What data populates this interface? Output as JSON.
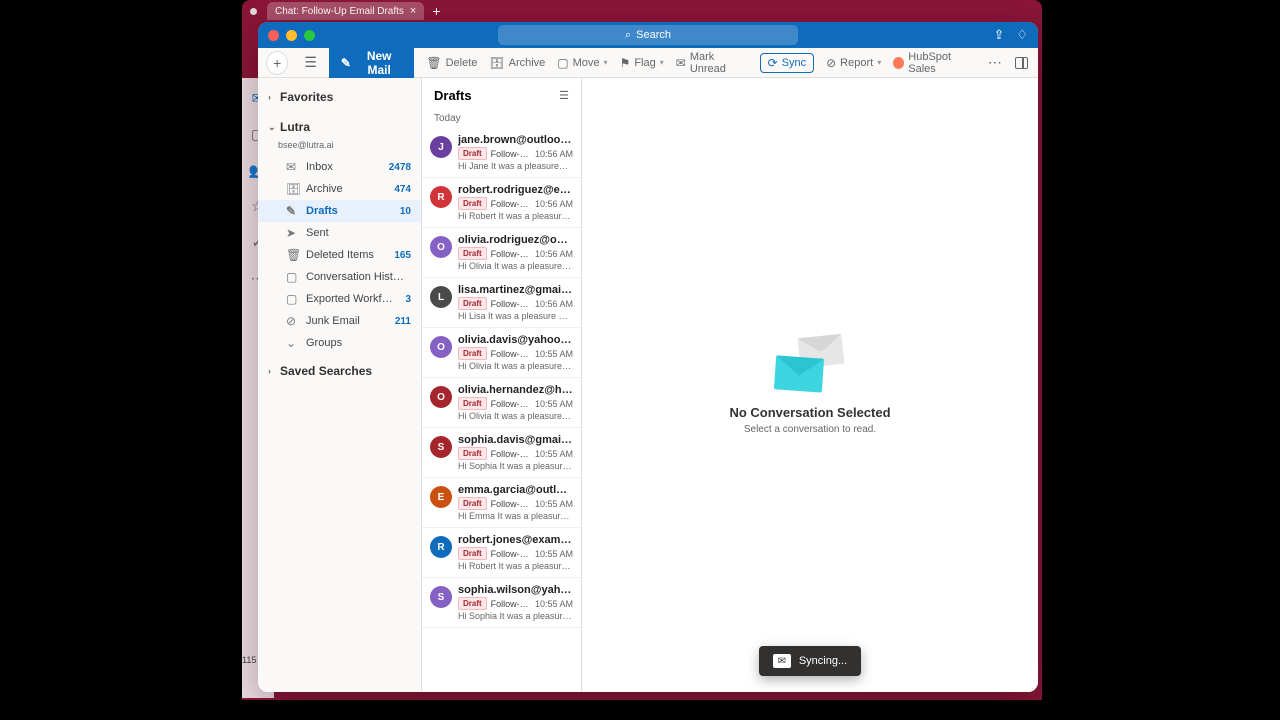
{
  "browser": {
    "tab_title": "Chat: Follow-Up Email Drafts"
  },
  "titlebar": {
    "search_placeholder": "Search"
  },
  "toolbar": {
    "new_mail": "New Mail",
    "delete": "Delete",
    "archive": "Archive",
    "move": "Move",
    "flag": "Flag",
    "mark_unread": "Mark Unread",
    "sync": "Sync",
    "report": "Report",
    "hubspot": "HubSpot Sales"
  },
  "sidebar": {
    "favorites": "Favorites",
    "account_name": "Lutra",
    "account_email": "bsee@lutra.ai",
    "folders": [
      {
        "name": "Inbox",
        "count": "2478",
        "icon": "✉"
      },
      {
        "name": "Archive",
        "count": "474",
        "icon": "🗄"
      },
      {
        "name": "Drafts",
        "count": "10",
        "icon": "✎",
        "selected": true
      },
      {
        "name": "Sent",
        "count": "",
        "icon": "➤"
      },
      {
        "name": "Deleted Items",
        "count": "165",
        "icon": "🗑"
      },
      {
        "name": "Conversation Hist…",
        "count": "",
        "icon": "▢"
      },
      {
        "name": "Exported Workf…",
        "count": "3",
        "icon": "▢"
      },
      {
        "name": "Junk Email",
        "count": "211",
        "icon": "⊘"
      },
      {
        "name": "Groups",
        "count": "",
        "icon": "⌄"
      }
    ],
    "saved_searches": "Saved Searches"
  },
  "msglist": {
    "title": "Drafts",
    "group": "Today",
    "draft_label": "Draft",
    "items": [
      {
        "initial": "J",
        "color": "#6b3fa0",
        "from": "jane.brown@outlook…",
        "subject": "Follow-…",
        "time": "10:56 AM",
        "preview": "Hi Jane It was a pleasure…"
      },
      {
        "initial": "R",
        "color": "#d13438",
        "from": "robert.rodriguez@exa…",
        "subject": "Follow-…",
        "time": "10:56 AM",
        "preview": "Hi Robert It was a pleasur…"
      },
      {
        "initial": "O",
        "color": "#8661c5",
        "from": "olivia.rodriguez@outl…",
        "subject": "Follow-…",
        "time": "10:56 AM",
        "preview": "Hi Olivia It was a pleasure…"
      },
      {
        "initial": "L",
        "color": "#4a4a4a",
        "from": "lisa.martinez@gmail.…",
        "subject": "Follow-…",
        "time": "10:56 AM",
        "preview": "Hi Lisa It was a pleasure m…"
      },
      {
        "initial": "O",
        "color": "#8661c5",
        "from": "olivia.davis@yahoo.c…",
        "subject": "Follow-…",
        "time": "10:55 AM",
        "preview": "Hi Olivia It was a pleasure…"
      },
      {
        "initial": "O",
        "color": "#a4262c",
        "from": "olivia.hernandez@hot…",
        "subject": "Follow-…",
        "time": "10:55 AM",
        "preview": "Hi Olivia It was a pleasure…"
      },
      {
        "initial": "S",
        "color": "#a4262c",
        "from": "sophia.davis@gmail.c…",
        "subject": "Follow-…",
        "time": "10:55 AM",
        "preview": "Hi Sophia It was a pleasur…"
      },
      {
        "initial": "E",
        "color": "#ca5010",
        "from": "emma.garcia@outloo…",
        "subject": "Follow-…",
        "time": "10:55 AM",
        "preview": "Hi Emma It was a pleasure…"
      },
      {
        "initial": "R",
        "color": "#0f6cbd",
        "from": "robert.jones@exampl…",
        "subject": "Follow-…",
        "time": "10:55 AM",
        "preview": "Hi Robert It was a pleasur…"
      },
      {
        "initial": "S",
        "color": "#8661c5",
        "from": "sophia.wilson@yahoo…",
        "subject": "Follow-…",
        "time": "10:55 AM",
        "preview": "Hi Sophia It was a pleasur…"
      }
    ]
  },
  "reading": {
    "title": "No Conversation Selected",
    "subtitle": "Select a conversation to read.",
    "syncing": "Syncing..."
  },
  "leftrail_hint": "115"
}
